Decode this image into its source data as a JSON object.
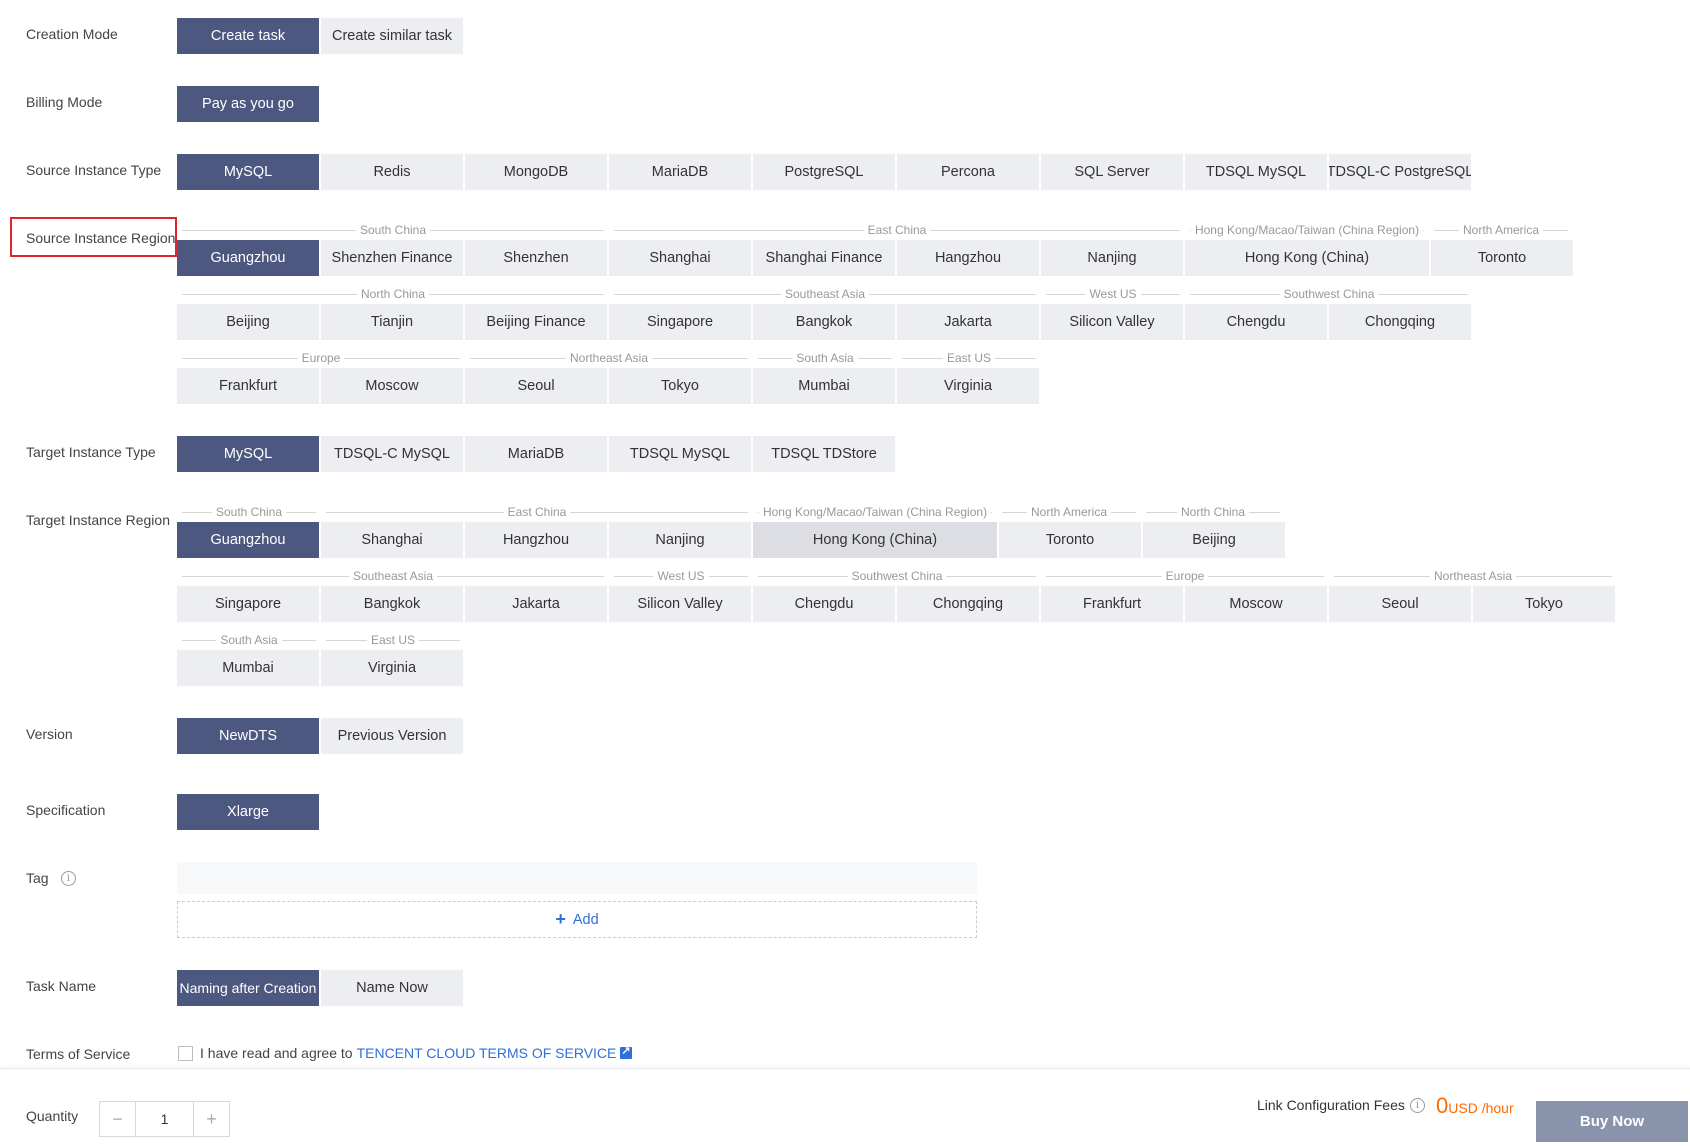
{
  "labels": {
    "creation_mode": "Creation Mode",
    "billing_mode": "Billing Mode",
    "source_type": "Source Instance Type",
    "source_region": "Source Instance Region",
    "target_type": "Target Instance Type",
    "target_region": "Target Instance Region",
    "version": "Version",
    "specification": "Specification",
    "tag": "Tag",
    "task_name": "Task Name",
    "terms": "Terms of Service",
    "quantity": "Quantity"
  },
  "creation_mode": [
    "Create task",
    "Create similar task"
  ],
  "billing_mode": [
    "Pay as you go"
  ],
  "source_types": [
    "MySQL",
    "Redis",
    "MongoDB",
    "MariaDB",
    "PostgreSQL",
    "Percona",
    "SQL Server",
    "TDSQL MySQL",
    "TDSQL-C PostgreSQL"
  ],
  "source_regions": {
    "groups": [
      "South China",
      "East China",
      "Hong Kong/Macao/Taiwan (China Region)",
      "North America",
      "North China",
      "Southeast Asia",
      "West US",
      "Southwest China",
      "Europe",
      "Northeast Asia",
      "South Asia",
      "East US"
    ],
    "items": [
      "Guangzhou",
      "Shenzhen Finance",
      "Shenzhen",
      "Shanghai",
      "Shanghai Finance",
      "Hangzhou",
      "Nanjing",
      "Hong Kong (China)",
      "Toronto",
      "Beijing",
      "Tianjin",
      "Beijing Finance",
      "Singapore",
      "Bangkok",
      "Jakarta",
      "Silicon Valley",
      "Chengdu",
      "Chongqing",
      "Frankfurt",
      "Moscow",
      "Seoul",
      "Tokyo",
      "Mumbai",
      "Virginia"
    ]
  },
  "target_types": [
    "MySQL",
    "TDSQL-C MySQL",
    "MariaDB",
    "TDSQL MySQL",
    "TDSQL TDStore"
  ],
  "target_regions": {
    "groups": [
      "South China",
      "East China",
      "Hong Kong/Macao/Taiwan (China Region)",
      "North America",
      "North China",
      "Southeast Asia",
      "West US",
      "Southwest China",
      "Europe",
      "Northeast Asia",
      "South Asia",
      "East US"
    ],
    "items": [
      "Guangzhou",
      "Shanghai",
      "Hangzhou",
      "Nanjing",
      "Hong Kong (China)",
      "Toronto",
      "Beijing",
      "Singapore",
      "Bangkok",
      "Jakarta",
      "Silicon Valley",
      "Chengdu",
      "Chongqing",
      "Frankfurt",
      "Moscow",
      "Seoul",
      "Tokyo",
      "Mumbai",
      "Virginia"
    ]
  },
  "versions": [
    "NewDTS",
    "Previous Version"
  ],
  "specifications": [
    "Xlarge"
  ],
  "tag": {
    "info_icon": "i",
    "add_icon": "+",
    "add_label": "Add"
  },
  "task_name_options": [
    "Naming after Creation",
    "Name Now"
  ],
  "terms": {
    "text": "I have read and agree to",
    "link": "TENCENT CLOUD TERMS OF SERVICE"
  },
  "footer": {
    "minus": "−",
    "quantity": "1",
    "plus": "+",
    "fee_label": "Link Configuration Fees",
    "fee_info_icon": "i",
    "fee_amount": "0",
    "fee_unit": "USD /hour",
    "buy_now": "Buy Now"
  },
  "colors": {
    "selected": "#4d5880",
    "option": "#edeef2",
    "link": "#2f6fdc",
    "price": "#ff6a00",
    "highlight_box": "#e0242b",
    "buy_button": "#8a93ac"
  }
}
